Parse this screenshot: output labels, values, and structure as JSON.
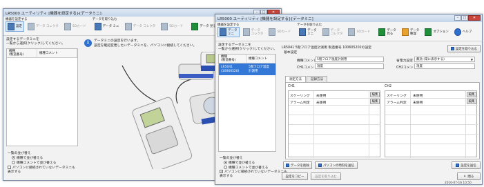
{
  "back_window": {
    "title": "LR5000 ユーティリティ [機器を設定する]-[データミニ]",
    "toolbar": {
      "group1_label": "機器を設定する",
      "group2_label": "データを取り込む",
      "buttons": [
        {
          "icon": "device-icon",
          "label": "設定"
        },
        {
          "icon": "data-icon",
          "label": "データ\nコレクタ"
        },
        {
          "icon": "card-icon",
          "label": "SDカード"
        },
        {
          "icon": "data-icon",
          "label": "データ\nミニ"
        },
        {
          "icon": "data-icon",
          "label": "データ\nコレクタ"
        },
        {
          "icon": "card-icon",
          "label": "SDカード"
        },
        {
          "icon": "graph-icon",
          "label": "データ\n見る"
        }
      ]
    },
    "list_instruction": "設定するデータミニを\n一覧から選択(クリック)してください。",
    "col_headers": [
      "機種\n(製造番号)",
      "機種コメント"
    ],
    "message": "データミニの設定を行います。\n設定を確認変更したいデータミニを、パソコンに接続してください。",
    "sort_label": "一覧の並び替え",
    "sort_options": [
      "機種で並び替える",
      "機種コメントで並び替える"
    ],
    "checkbox_label": "パソコンに接続されていないデータミニも\n表示する"
  },
  "front_window": {
    "title": "LR5000 ユーティリティ [機器を設定する]-[データミニ]",
    "toolbar": {
      "group1_label": "機器を設定する",
      "group2_label": "データを取り込む",
      "buttons": [
        {
          "label": "データ\nミニ"
        },
        {
          "label": "データ\nコレクタ"
        },
        {
          "label": "SDカード"
        },
        {
          "label": "データ\nミニ"
        },
        {
          "label": "データ\nコレクタ"
        },
        {
          "label": "SDカード"
        },
        {
          "label": "データ\n見る"
        },
        {
          "label": "データ\n整理"
        },
        {
          "label": "オプション"
        },
        {
          "label": "ヘルプ"
        }
      ]
    },
    "list_instruction": "設定するデータミニを\n一覧から選択(クリック)してください。",
    "col_headers": [
      "機種\n(製造番号)",
      "機種コメント"
    ],
    "list_item": {
      "model": "LR5041\n(10060520)",
      "comment": "5階フロア温度\n計測用"
    },
    "device_header": "LR5041 5階フロア温度計測用 製造番号 100605202の設定",
    "basic_settings": "基本設定",
    "device_comment_label": "機種コメント",
    "device_comment_value": "5階フロア温度計測用",
    "ch1_comment_label": "CH1コメント",
    "ch1_comment_value": "温度",
    "power_saving_label": "省電力設定",
    "power_saving_value": "無効 (常に表示する)",
    "ch2_comment_label": "CH2コメント",
    "ch2_comment_value": "湿度",
    "load_settings_button": "設定を取り込む",
    "tabs": [
      "測定方法",
      "記録方法"
    ],
    "ch1_label": "CH1",
    "ch2_label": "CH2",
    "scaling_label": "スケーリング",
    "scaling_value": "未使用",
    "alarm_label": "アラーム判定",
    "alarm_value": "未使用",
    "edit_label": "編集",
    "delete_data_button": "データを削除",
    "time_sync_button": "パソコンの時刻を送信",
    "send_settings_button": "設定を送信",
    "sort_label": "一覧の並び替え",
    "sort_options": [
      "機種で並び替える",
      "機種コメントで並び替える"
    ],
    "checkbox_label": "パソコンに接続されていないデータミニも\n表示する",
    "copy_settings_button": "設定をコピー",
    "load_file_button": "設定を取り込む",
    "close_button": "閉る",
    "status_date": "2010-07-16 10:50"
  }
}
